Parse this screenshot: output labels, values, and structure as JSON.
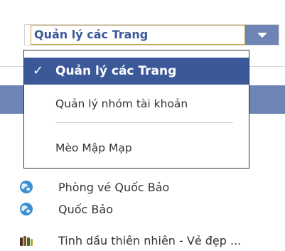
{
  "dropdown": {
    "selected_label": "Quản lý các Trang",
    "options": [
      {
        "label": "Quản lý các Trang",
        "selected": true
      },
      {
        "label": "Quản lý nhóm tài khoản",
        "selected": false
      },
      {
        "label": "Mèo Mập Mạp",
        "selected": false
      }
    ]
  },
  "pages": [
    {
      "label": "Phòng vé Quốc Bảo",
      "icon": "globe-icon"
    },
    {
      "label": "Quốc Bảo",
      "icon": "globe-icon"
    },
    {
      "label": "Tinh dầu thiên nhiên - Vẻ đẹp ...",
      "icon": "bottles-icon"
    }
  ],
  "colors": {
    "facebook_blue": "#3b5998",
    "menu_band": "#6d84b4",
    "focus_border": "#c9a04f"
  }
}
